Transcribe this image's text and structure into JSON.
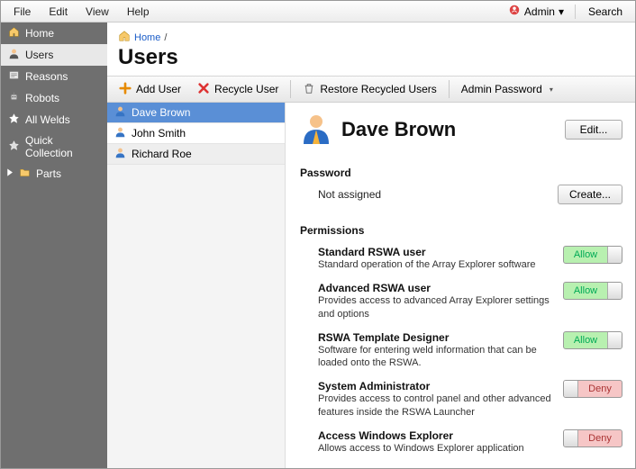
{
  "menubar": {
    "file": "File",
    "edit": "Edit",
    "view": "View",
    "help": "Help",
    "admin": "Admin",
    "search": "Search"
  },
  "sidebar": {
    "items": [
      {
        "label": "Home"
      },
      {
        "label": "Users"
      },
      {
        "label": "Reasons"
      },
      {
        "label": "Robots"
      },
      {
        "label": "All Welds"
      },
      {
        "label": "Quick Collection"
      },
      {
        "label": "Parts"
      }
    ]
  },
  "breadcrumb": {
    "home": "Home",
    "sep": "/"
  },
  "page": {
    "title": "Users"
  },
  "toolbar": {
    "add": "Add User",
    "recycle": "Recycle User",
    "restore": "Restore Recycled Users",
    "adminpw": "Admin Password"
  },
  "userlist": [
    {
      "name": "Dave Brown"
    },
    {
      "name": "John Smith"
    },
    {
      "name": "Richard Roe"
    }
  ],
  "detail": {
    "name": "Dave Brown",
    "edit": "Edit...",
    "pw_section": "Password",
    "pw_value": "Not assigned",
    "pw_create": "Create...",
    "perm_section": "Permissions",
    "allow": "Allow",
    "deny": "Deny",
    "perms": [
      {
        "title": "Standard RSWA user",
        "desc": "Standard operation of the Array Explorer software",
        "state": "allow"
      },
      {
        "title": "Advanced RSWA user",
        "desc": "Provides access to advanced Array Explorer settings and options",
        "state": "allow"
      },
      {
        "title": "RSWA Template Designer",
        "desc": "Software for entering weld information that can be loaded onto the RSWA.",
        "state": "allow"
      },
      {
        "title": "System Administrator",
        "desc": "Provides access to control panel and other advanced features inside the RSWA Launcher",
        "state": "deny"
      },
      {
        "title": "Access Windows Explorer",
        "desc": "Allows access to Windows Explorer application",
        "state": "deny"
      }
    ]
  }
}
